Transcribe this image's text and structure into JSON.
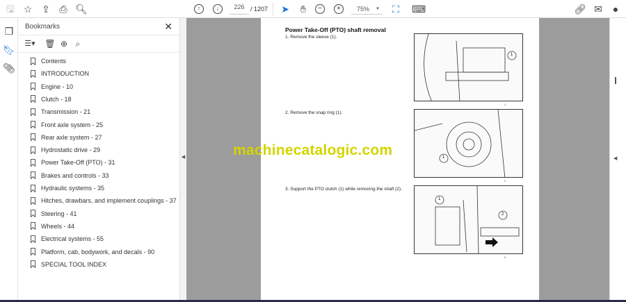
{
  "toolbar": {
    "page_current": "226",
    "page_total": "/ 1207",
    "zoom": "75%"
  },
  "bookmarks": {
    "title": "Bookmarks",
    "close": "✕",
    "items": [
      {
        "label": "Contents"
      },
      {
        "label": "INTRODUCTION"
      },
      {
        "label": "Engine - 10"
      },
      {
        "label": "Clutch - 18"
      },
      {
        "label": "Transmission - 21"
      },
      {
        "label": "Front axle system - 25"
      },
      {
        "label": "Rear axle system - 27"
      },
      {
        "label": "Hydrostatic drive - 29"
      },
      {
        "label": "Power Take-Off (PTO) - 31"
      },
      {
        "label": "Brakes and controls - 33"
      },
      {
        "label": "Hydraulic systems - 35"
      },
      {
        "label": "Hitches, drawbars, and implement couplings - 37"
      },
      {
        "label": "Steering - 41"
      },
      {
        "label": "Wheels - 44"
      },
      {
        "label": "Electrical systems - 55"
      },
      {
        "label": "Platform, cab, bodywork, and decals - 90"
      },
      {
        "label": "SPECIAL TOOL INDEX"
      }
    ]
  },
  "document": {
    "heading": "Power Take-Off (PTO) shaft removal",
    "steps": [
      "1.   Remove the sleeve (1).",
      "2.   Remove the snap ring (1).",
      "3.   Support the PTO clutch (1) while removing the shaft (2)."
    ],
    "figure_numbers": [
      "1",
      "2",
      "3"
    ],
    "callouts": [
      "1",
      "1",
      "1",
      "2"
    ]
  },
  "watermark": "machinecatalogic.com",
  "colors": {
    "watermark": "#d4d400",
    "accent": "#1a73d9"
  }
}
